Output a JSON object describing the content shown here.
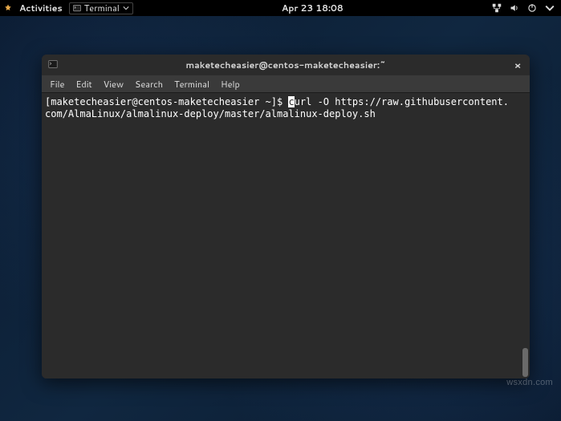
{
  "topbar": {
    "activities_label": "Activities",
    "app_name": "Terminal",
    "clock": "Apr 23  18:08"
  },
  "window": {
    "title": "maketecheasier@centos-maketecheasier:~",
    "close_glyph": "×"
  },
  "menubar": {
    "file": "File",
    "edit": "Edit",
    "view": "View",
    "search": "Search",
    "terminal": "Terminal",
    "help": "Help"
  },
  "terminal": {
    "prompt": "[maketecheasier@centos-maketecheasier ~]$ ",
    "cursor_char": "c",
    "command_rest_line1": "url -O https://raw.githubusercontent.",
    "command_line2": "com/AlmaLinux/almalinux-deploy/master/almalinux-deploy.sh"
  },
  "watermark": "wsxdn.com"
}
